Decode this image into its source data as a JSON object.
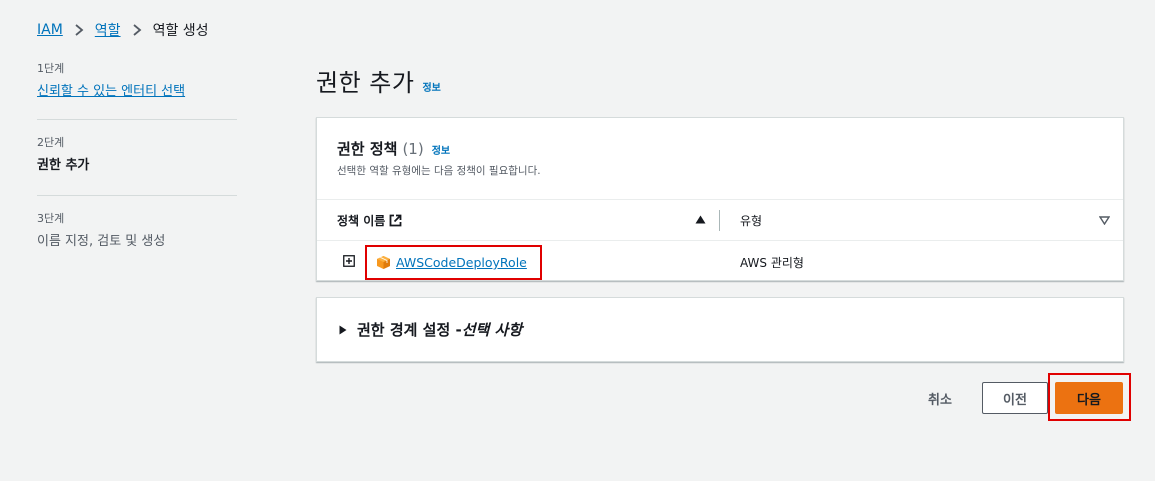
{
  "breadcrumb": {
    "items": [
      "IAM",
      "역할",
      "역할 생성"
    ]
  },
  "steps": [
    {
      "number": "1단계",
      "title": "신뢰할 수 있는 엔터티 선택"
    },
    {
      "number": "2단계",
      "title": "권한 추가"
    },
    {
      "number": "3단계",
      "title": "이름 지정, 검토 및 생성"
    }
  ],
  "page": {
    "title": "권한 추가",
    "info": "정보"
  },
  "policies_panel": {
    "title": "권한 정책",
    "count": "(1)",
    "info": "정보",
    "description": "선택한 역할 유형에는 다음 정책이 필요합니다.",
    "columns": {
      "name": "정책 이름",
      "type": "유형"
    },
    "rows": [
      {
        "name": "AWSCodeDeployRole",
        "type": "AWS 관리형"
      }
    ]
  },
  "boundary_panel": {
    "title": "권한 경계 설정 - ",
    "optional": "선택 사항"
  },
  "actions": {
    "cancel": "취소",
    "previous": "이전",
    "next": "다음"
  },
  "colors": {
    "link": "#0073bb",
    "primary_button": "#ec7211",
    "highlight_box": "#e00000",
    "background": "#f2f3f3"
  },
  "icons": [
    "chevron-right-icon",
    "external-link-icon",
    "sort-ascending-icon",
    "sort-descending-icon",
    "expand-plus-icon",
    "aws-managed-policy-icon",
    "caret-right-icon"
  ]
}
